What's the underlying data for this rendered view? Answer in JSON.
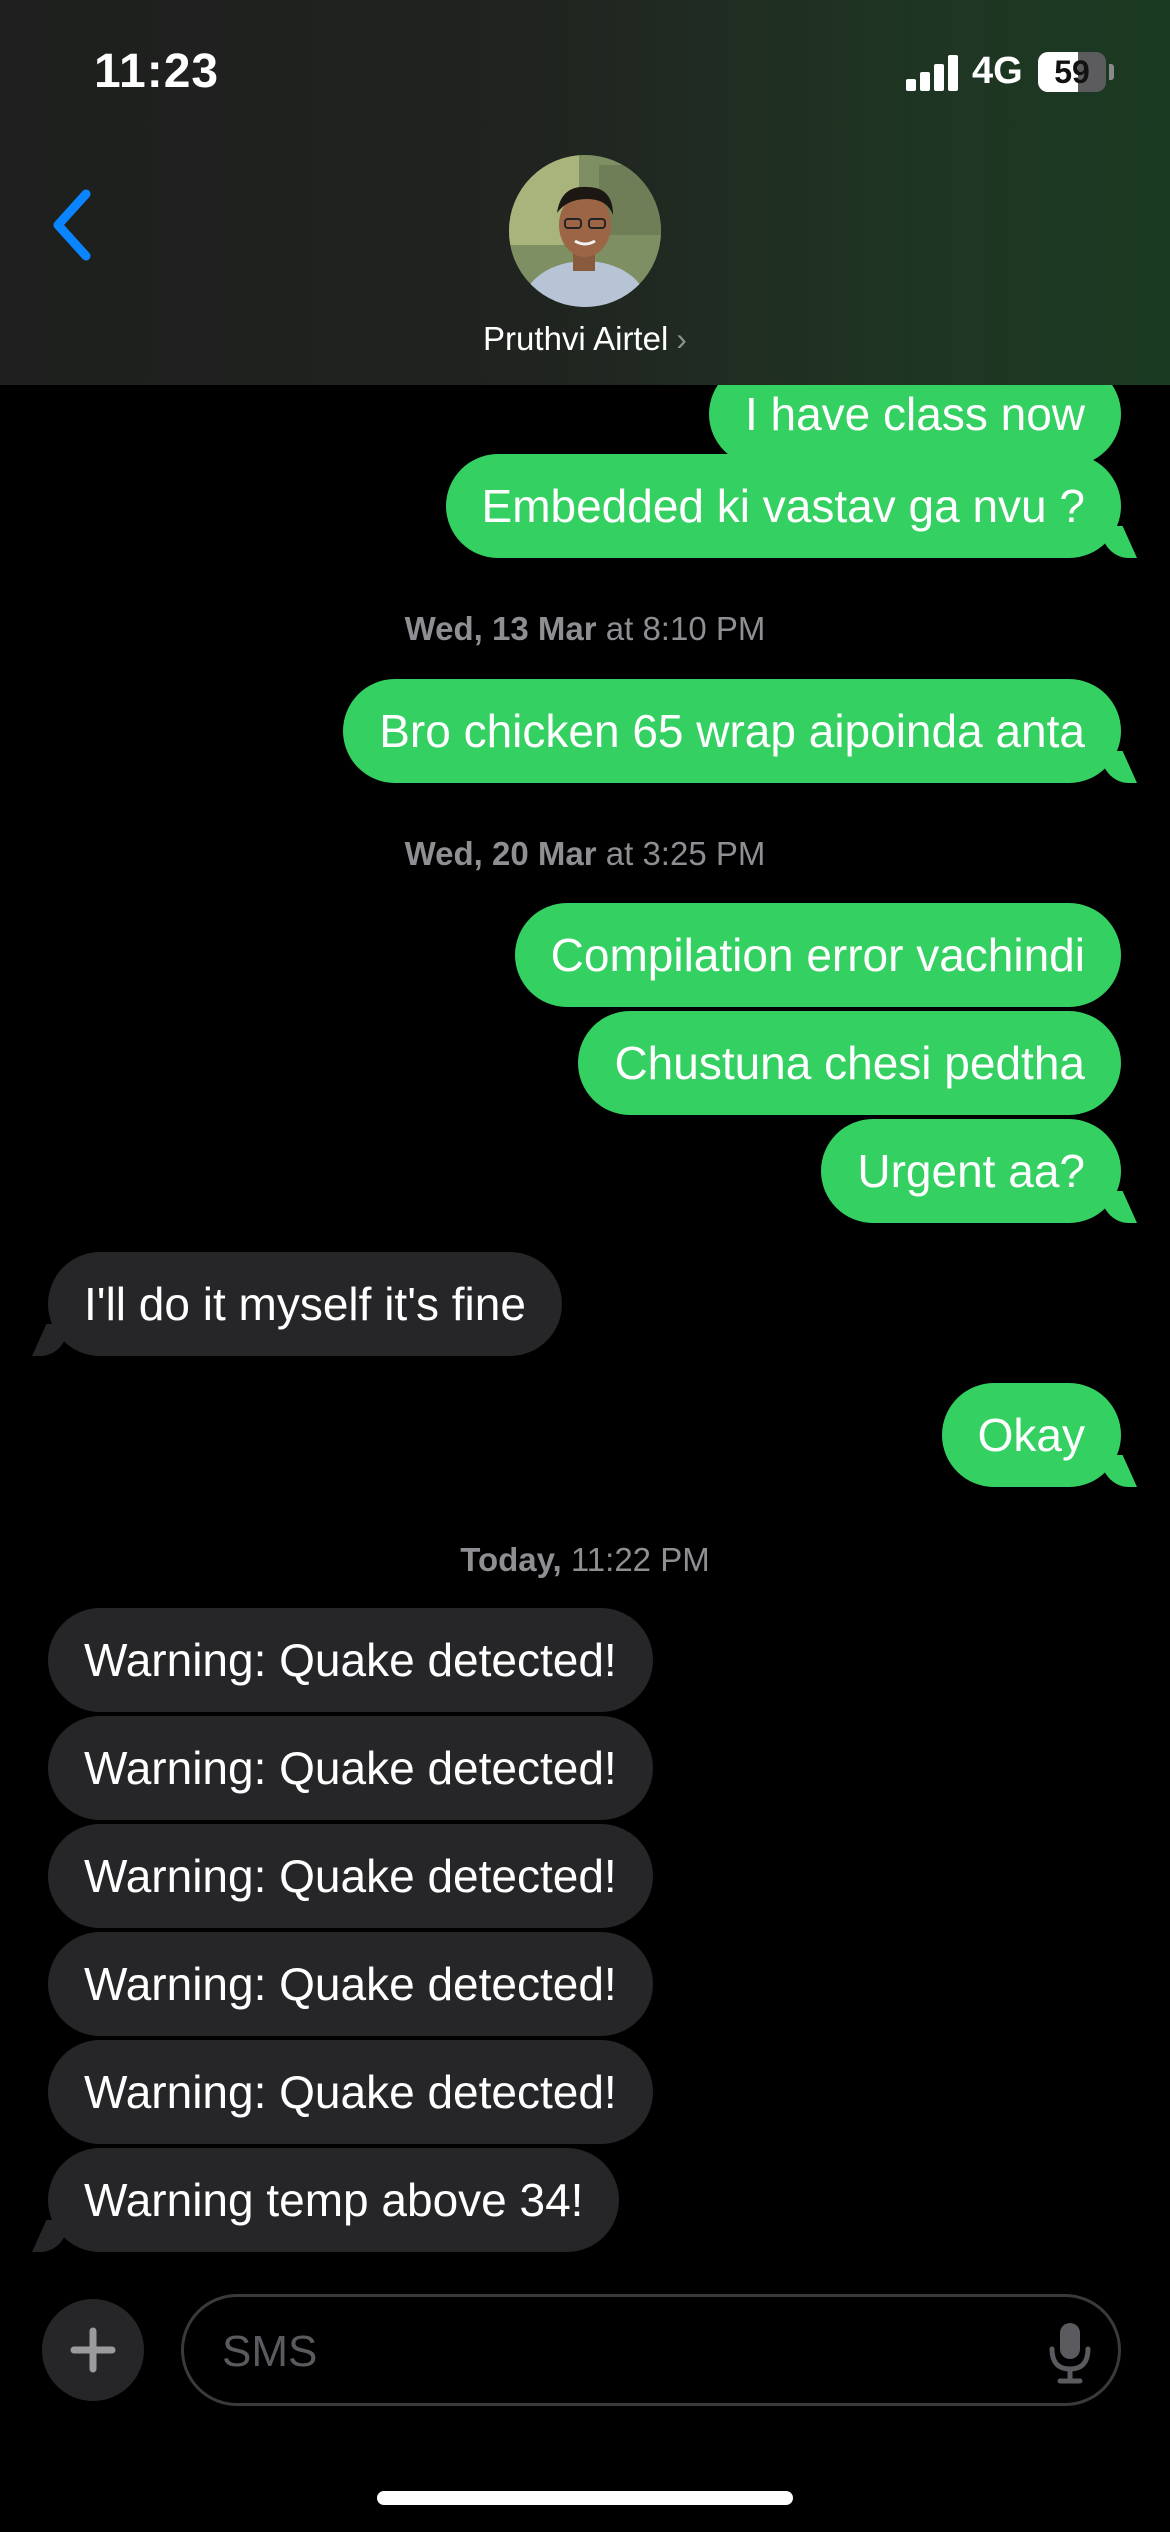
{
  "status_bar": {
    "time": "11:23",
    "network": "4G",
    "battery_level": "59",
    "battery_fraction": 0.59
  },
  "header": {
    "contact_name": "Pruthvi Airtel",
    "name_chevron": "›",
    "back_icon": "chevron-left-icon"
  },
  "colors": {
    "sent_bubble": "#35d062",
    "received_bubble": "#262628",
    "accent_blue": "#0a84ff",
    "timestamp_gray": "#8e8e93"
  },
  "messages": {
    "m1": "I have class now",
    "m2": "Embedded ki vastav ga nvu ?",
    "ts1_day": "Wed, 13 Mar",
    "ts1_time": "at 8:10 PM",
    "m3": "Bro chicken 65 wrap aipoinda anta",
    "ts2_day": "Wed, 20 Mar",
    "ts2_time": "at 3:25 PM",
    "m4": "Compilation error vachindi",
    "m5": "Chustuna chesi pedtha",
    "m6": "Urgent aa?",
    "m7": "I'll do it myself it's fine",
    "m8": "Okay",
    "ts3_day": "Today,",
    "ts3_time": "11:22 PM",
    "m9": "Warning: Quake detected!",
    "m10": "Warning: Quake detected!",
    "m11": "Warning: Quake detected!",
    "m12": "Warning: Quake detected!",
    "m13": "Warning: Quake detected!",
    "m14": "Warning temp above 34!"
  },
  "input_bar": {
    "placeholder": "SMS",
    "plus_icon": "plus-icon",
    "mic_icon": "microphone-icon"
  }
}
